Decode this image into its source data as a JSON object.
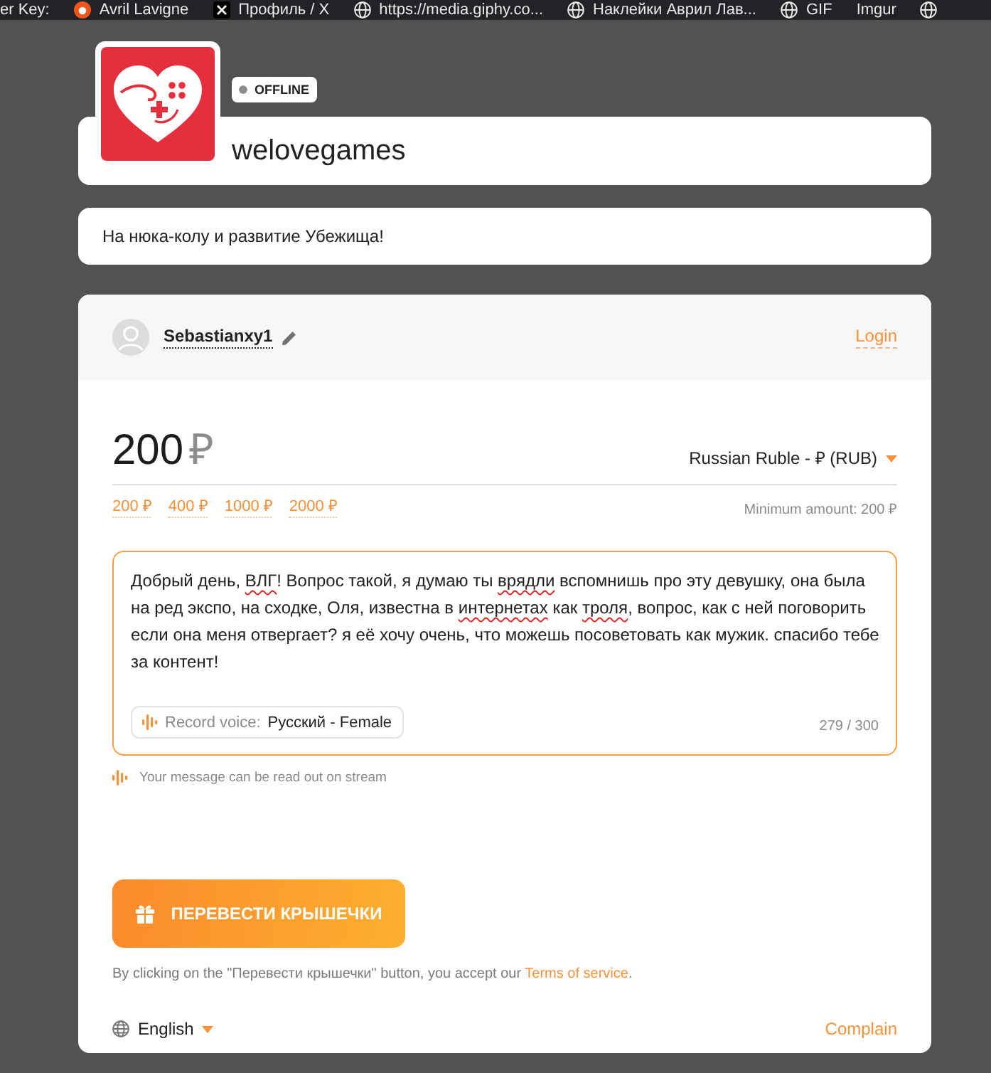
{
  "bookmarks": [
    {
      "kind": "plain",
      "label": "er Key:"
    },
    {
      "kind": "circle",
      "label": "Avril Lavigne"
    },
    {
      "kind": "square",
      "label": "Профиль / X"
    },
    {
      "kind": "globe",
      "label": "https://media.giphy.co..."
    },
    {
      "kind": "globe",
      "label": "Наклейки Аврил Лав..."
    },
    {
      "kind": "globe",
      "label": "GIF"
    },
    {
      "kind": "plain",
      "label": "Imgur"
    },
    {
      "kind": "globe"
    }
  ],
  "channel": {
    "status": {
      "label": "OFFLINE",
      "online": false
    },
    "name": "welovegames",
    "description": "На нюка-колу и развитие Убежища!"
  },
  "donor": {
    "name": "Sebastianxy1",
    "login": "Login"
  },
  "amount": {
    "value": "200",
    "sign": "₽",
    "currency": "Russian Ruble - ₽ (RUB)",
    "presets": [
      "200 ₽",
      "400 ₽",
      "1000 ₽",
      "2000 ₽"
    ],
    "minimum": "Minimum amount: 200 ₽"
  },
  "message": {
    "segments": [
      {
        "text": "Добрый день, ",
        "misspelled": false
      },
      {
        "text": "ВЛГ",
        "misspelled": true
      },
      {
        "text": "! Вопрос такой, я думаю ты ",
        "misspelled": false
      },
      {
        "text": "врядли",
        "misspelled": true
      },
      {
        "text": " вспомнишь про эту девушку, она была на ред экспо, на сходке, Оля, известна в ",
        "misspelled": false
      },
      {
        "text": "интернетах",
        "misspelled": true
      },
      {
        "text": " как ",
        "misspelled": false
      },
      {
        "text": "троля",
        "misspelled": true
      },
      {
        "text": ", вопрос, как с ней поговорить если она меня отвергает? я её хочу очень, что можешь посоветовать как мужик. спасибо тебе за контент!",
        "misspelled": false
      }
    ],
    "voice": {
      "label": "Record voice:",
      "value": "Русский - Female"
    },
    "counter": "279 / 300",
    "note": "Your message can be read out on stream"
  },
  "submit": {
    "label": "ПЕРЕВЕСТИ КРЫШЕЧКИ"
  },
  "terms": {
    "text": "By clicking on the \"Перевести крышечки\" button, you accept our ",
    "link": "Terms of service",
    "end": "."
  },
  "footer": {
    "language": "English",
    "complain": "Complain"
  }
}
